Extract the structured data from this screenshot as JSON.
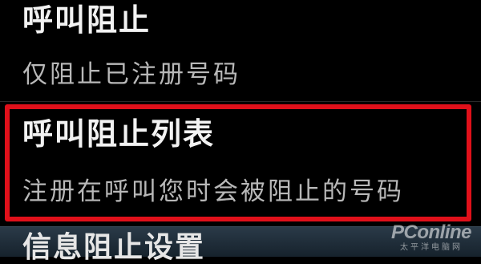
{
  "settings": {
    "items": [
      {
        "title": "呼叫阻止",
        "summary": "仅阻止已注册号码"
      },
      {
        "title": "呼叫阻止列表",
        "summary": "注册在呼叫您时会被阻止的号码"
      },
      {
        "title": "信息阻止设置"
      }
    ]
  },
  "highlight": {
    "color": "#e0101a",
    "target": "呼叫阻止列表"
  },
  "watermark": {
    "logo": "PConline",
    "subtitle": "太平洋电脑网"
  }
}
